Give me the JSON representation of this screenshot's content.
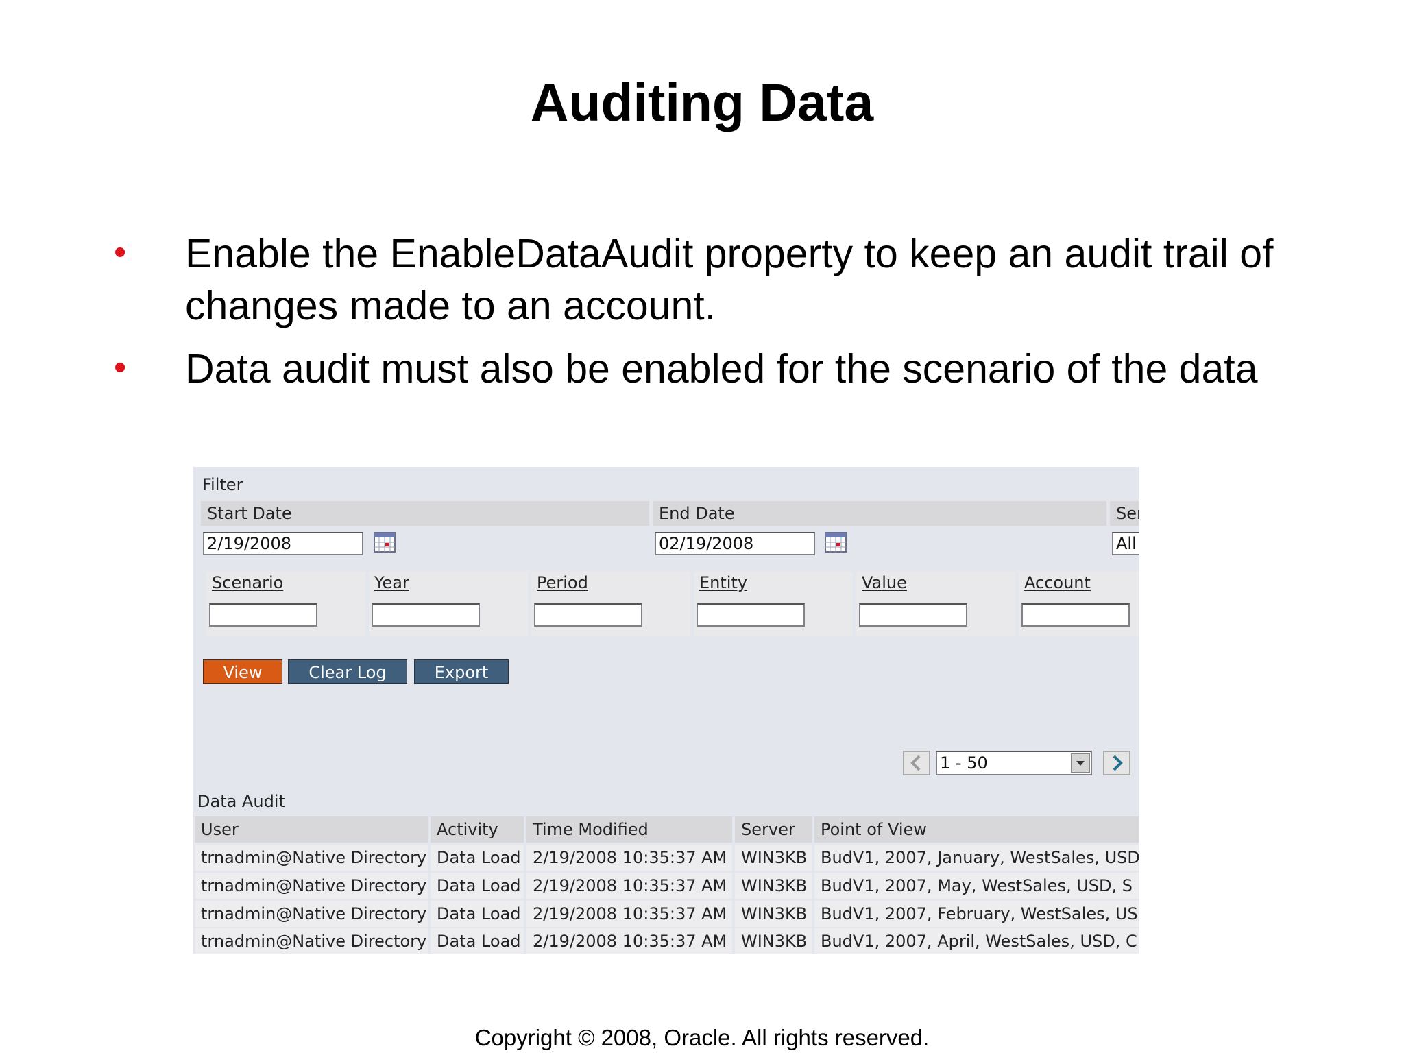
{
  "slide": {
    "title": "Auditing Data",
    "bullets": [
      "Enable the EnableDataAudit property to keep an audit trail of changes made to an account.",
      "Data audit must also be enabled for the scenario of the data"
    ],
    "footer": "Copyright © 2008, Oracle. All rights reserved."
  },
  "filter": {
    "section_label": "Filter",
    "start_date_label": "Start Date",
    "start_date_value": "2/19/2008",
    "end_date_label": "End Date",
    "end_date_value": "02/19/2008",
    "server_label": "Ser",
    "server_value": "All",
    "dimensions": [
      "Scenario",
      "Year",
      "Period",
      "Entity",
      "Value",
      "Account"
    ]
  },
  "buttons": {
    "view": "View",
    "clear_log": "Clear Log",
    "export": "Export"
  },
  "pager": {
    "range": "1 - 50"
  },
  "audit": {
    "section_label": "Data Audit",
    "columns": [
      "User",
      "Activity",
      "Time Modified",
      "Server",
      "Point of View"
    ],
    "rows": [
      [
        "trnadmin@Native Directory",
        "Data Load",
        "2/19/2008 10:35:37 AM",
        "WIN3KB",
        "BudV1, 2007, January, WestSales, USD"
      ],
      [
        "trnadmin@Native Directory",
        "Data Load",
        "2/19/2008 10:35:37 AM",
        "WIN3KB",
        "BudV1, 2007, May, WestSales, USD, S"
      ],
      [
        "trnadmin@Native Directory",
        "Data Load",
        "2/19/2008 10:35:37 AM",
        "WIN3KB",
        "BudV1, 2007, February, WestSales, US"
      ],
      [
        "trnadmin@Native Directory",
        "Data Load",
        "2/19/2008 10:35:37 AM",
        "WIN3KB",
        "BudV1, 2007, April, WestSales, USD, C"
      ]
    ]
  },
  "colors": {
    "bullet": "#e0121b",
    "view_button": "#d85a14",
    "secondary_button": "#3f5f7c",
    "panel_bg": "#e4e6ee"
  }
}
